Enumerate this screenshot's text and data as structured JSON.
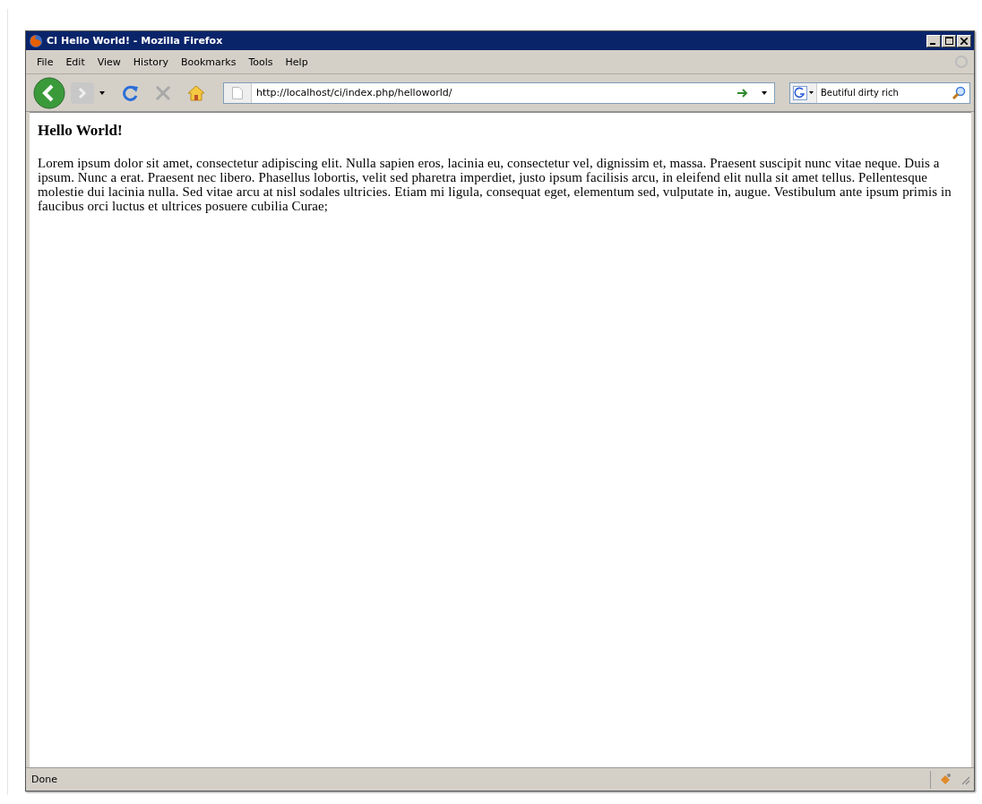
{
  "window": {
    "title": "CI Hello World! - Mozilla Firefox"
  },
  "menu": [
    "File",
    "Edit",
    "View",
    "History",
    "Bookmarks",
    "Tools",
    "Help"
  ],
  "toolbar": {
    "address": "http://localhost/ci/index.php/helloworld/",
    "search": {
      "value": "Beutiful dirty rich"
    }
  },
  "page": {
    "heading": "Hello World!",
    "paragraph": "Lorem ipsum dolor sit amet, consectetur adipiscing elit. Nulla sapien eros, lacinia eu, consectetur vel, dignissim et, massa. Praesent suscipit nunc vitae neque. Duis a ipsum. Nunc a erat. Praesent nec libero. Phasellus lobortis, velit sed pharetra imperdiet, justo ipsum facilisis arcu, in eleifend elit nulla sit amet tellus. Pellentesque molestie dui lacinia nulla. Sed vitae arcu at nisl sodales ultricies. Etiam mi ligula, consequat eget, elementum sed, vulputate in, augue. Vestibulum ante ipsum primis in faucibus orci luctus et ultrices posuere cubilia Curae;"
  },
  "status_bar": {
    "text": "Done"
  }
}
